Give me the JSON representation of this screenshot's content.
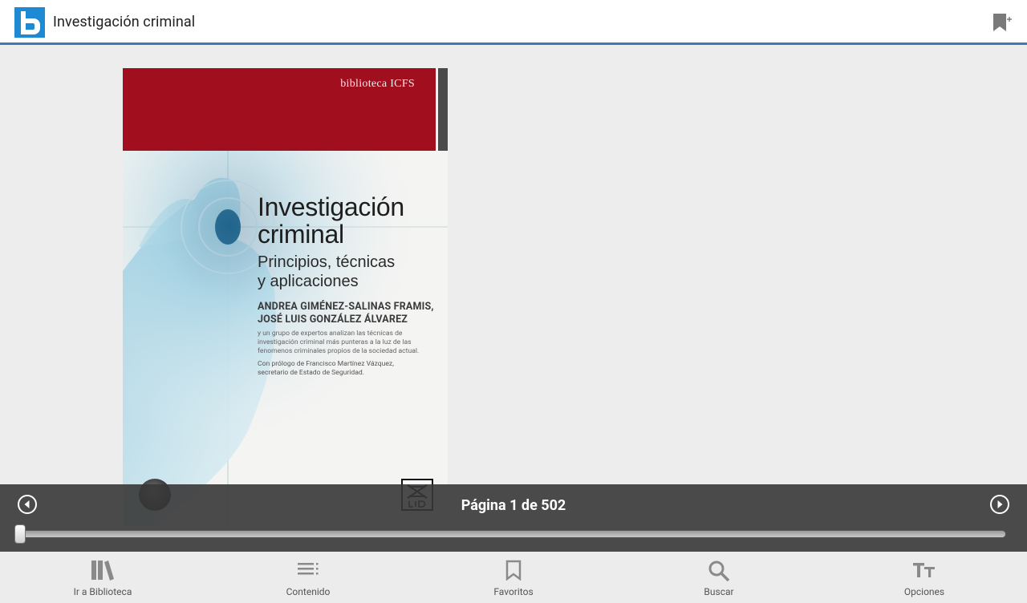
{
  "app": {
    "title": "Investigación criminal",
    "accent_color": "#3d79b8",
    "logo_icon": "app-logo-icon",
    "bookmark_icon": "bookmark-add-icon"
  },
  "book_page": {
    "publisher": "biblioteca ICFS",
    "title_line1": "Investigación",
    "title_line2": "criminal",
    "subtitle_line1": "Principios, técnicas",
    "subtitle_line2": "y aplicaciones",
    "author1": "ANDREA GIMÉNEZ-SALINAS FRAMIS,",
    "author2": "JOSÉ LUIS GONZÁLEZ ÁLVAREZ",
    "blurb": "y un grupo de expertos analizan las técnicas de investigación criminal más punteras a la luz de las fenomenos criminales propios de la sociedad actual.",
    "prologue_line1": "Con prólogo de Francisco Martínez Vázquez,",
    "prologue_line2": "secretario de Estado de Seguridad.",
    "band_color": "#a10f1e"
  },
  "pager": {
    "indicator": "Página 1 de 502",
    "current_page": 1,
    "total_pages": 502
  },
  "bottom_nav": [
    {
      "label": "Ir a Biblioteca",
      "icon": "library-icon"
    },
    {
      "label": "Contenido",
      "icon": "contents-list-icon"
    },
    {
      "label": "Favoritos",
      "icon": "bookmark-icon"
    },
    {
      "label": "Buscar",
      "icon": "search-icon"
    },
    {
      "label": "Opciones",
      "icon": "text-size-icon"
    }
  ]
}
